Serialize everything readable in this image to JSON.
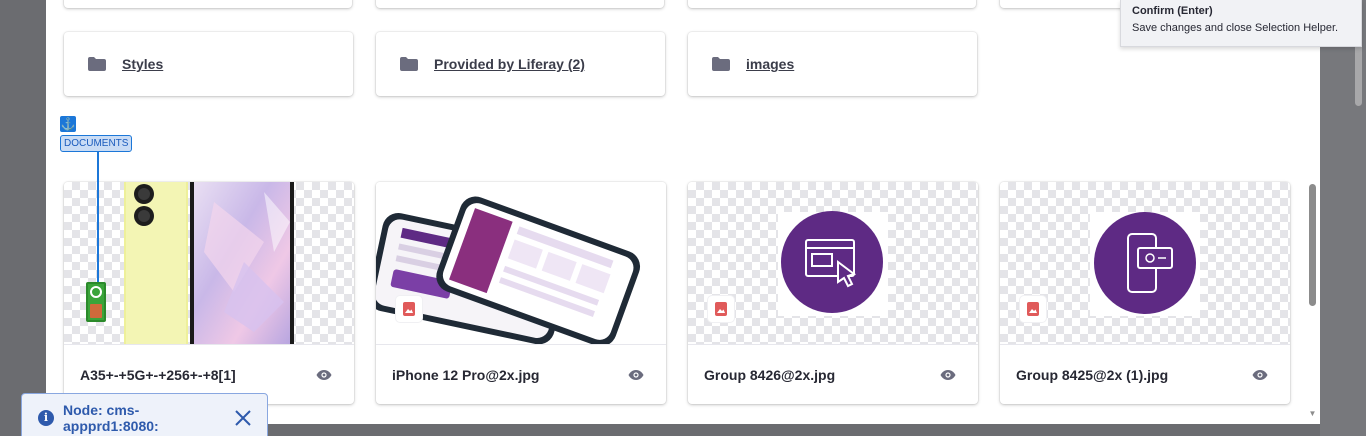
{
  "tooltip": {
    "title": "Confirm (Enter)",
    "description": "Save changes and close Selection Helper."
  },
  "folders": [
    {
      "label": "Styles"
    },
    {
      "label": "Provided by Liferay (2)"
    },
    {
      "label": "images"
    }
  ],
  "section_marker": {
    "anchor_icon": "anchor-icon",
    "label": "DOCUMENTS"
  },
  "documents": [
    {
      "name": "A35+-+5G+-+256+-+8[1]",
      "preview": "phone-yellow-crystal"
    },
    {
      "name": "iPhone 12 Pro@2x.jpg",
      "preview": "iphone-app-screens"
    },
    {
      "name": "Group 8426@2x.jpg",
      "preview": "purple-circle-browser-click"
    },
    {
      "name": "Group 8425@2x (1).jpg",
      "preview": "purple-circle-mobile-payment"
    }
  ],
  "toast": {
    "text": "Node: cms-appprd1:8080:",
    "icon": "info-icon",
    "close_icon": "close-icon"
  },
  "colors": {
    "accent": "#1c77d8",
    "brand_purple": "#5e2a84",
    "file_icon": "#e05a5a"
  }
}
